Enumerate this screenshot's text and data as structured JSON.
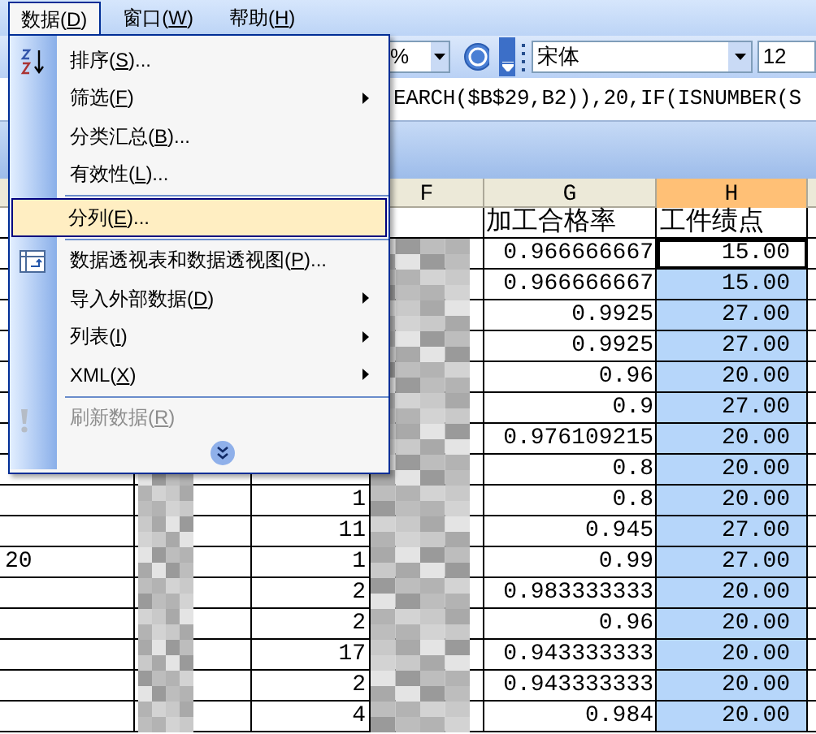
{
  "menubar": [
    {
      "before": "数据(",
      "key": "D",
      "after": ")",
      "selected": true
    },
    {
      "before": "窗口(",
      "key": "W",
      "after": ")",
      "selected": false
    },
    {
      "before": "帮助(",
      "key": "H",
      "after": ")",
      "selected": false
    }
  ],
  "toolbar": {
    "zoom": "%",
    "font": "宋体",
    "size": "12"
  },
  "formula": "EARCH($B$29,B2)),20,IF(ISNUMBER(S",
  "columns": [
    {
      "label": "F",
      "selected": false
    },
    {
      "label": "G",
      "selected": false
    },
    {
      "label": "H",
      "selected": true
    }
  ],
  "rows": [
    {
      "g": "加工合格率",
      "h": "工件绩点",
      "kind": "header",
      "selected": false,
      "active": false
    },
    {
      "g": "0.966666667",
      "h": "15.00",
      "kind": "number",
      "selected": false,
      "active": true
    },
    {
      "g": "0.966666667",
      "h": "15.00",
      "kind": "number",
      "selected": true,
      "active": false
    },
    {
      "g": "0.9925",
      "h": "27.00",
      "kind": "number",
      "selected": true,
      "active": false
    },
    {
      "g": "0.9925",
      "h": "27.00",
      "kind": "number",
      "selected": true,
      "active": false
    },
    {
      "g": "0.96",
      "h": "20.00",
      "kind": "number",
      "selected": true,
      "active": false
    },
    {
      "g": "0.9",
      "h": "27.00",
      "kind": "number",
      "selected": true,
      "active": false
    },
    {
      "g": "0.976109215",
      "h": "20.00",
      "kind": "number",
      "selected": true,
      "active": false
    },
    {
      "g": "0.8",
      "h": "20.00",
      "kind": "number",
      "selected": true,
      "active": false
    },
    {
      "e": "1",
      "g": "0.8",
      "h": "20.00",
      "kind": "number",
      "selected": true,
      "active": false
    },
    {
      "e": "11",
      "g": "0.945",
      "h": "27.00",
      "kind": "number",
      "selected": true,
      "active": false
    },
    {
      "a": "20",
      "e": "1",
      "g": "0.99",
      "h": "27.00",
      "kind": "number",
      "selected": true,
      "active": false
    },
    {
      "e": "2",
      "g": "0.983333333",
      "h": "20.00",
      "kind": "number",
      "selected": true,
      "active": false
    },
    {
      "e": "2",
      "g": "0.96",
      "h": "20.00",
      "kind": "number",
      "selected": true,
      "active": false
    },
    {
      "e": "17",
      "g": "0.943333333",
      "h": "20.00",
      "kind": "number",
      "selected": true,
      "active": false
    },
    {
      "e": "2",
      "g": "0.943333333",
      "h": "20.00",
      "kind": "number",
      "selected": true,
      "active": false
    },
    {
      "e": "4",
      "g": "0.984",
      "h": "20.00",
      "kind": "number",
      "selected": true,
      "active": false
    }
  ],
  "menu": {
    "items": [
      {
        "kind": "item",
        "before": "排序(",
        "key": "S",
        "after": ")...",
        "submenu": false,
        "disabled": false,
        "selected": false
      },
      {
        "kind": "item",
        "before": "筛选(",
        "key": "F",
        "after": ")",
        "submenu": true,
        "disabled": false,
        "selected": false
      },
      {
        "kind": "item",
        "before": "分类汇总(",
        "key": "B",
        "after": ")...",
        "submenu": false,
        "disabled": false,
        "selected": false
      },
      {
        "kind": "item",
        "before": "有效性(",
        "key": "L",
        "after": ")...",
        "submenu": false,
        "disabled": false,
        "selected": false
      },
      {
        "kind": "separator"
      },
      {
        "kind": "item",
        "before": "分列(",
        "key": "E",
        "after": ")...",
        "submenu": false,
        "disabled": false,
        "selected": true
      },
      {
        "kind": "separator"
      },
      {
        "kind": "item",
        "before": "数据透视表和数据透视图(",
        "key": "P",
        "after": ")...",
        "submenu": false,
        "disabled": false,
        "selected": false
      },
      {
        "kind": "item",
        "before": "导入外部数据(",
        "key": "D",
        "after": ")",
        "submenu": true,
        "disabled": false,
        "selected": false
      },
      {
        "kind": "item",
        "before": "列表(",
        "key": "I",
        "after": ")",
        "submenu": true,
        "disabled": false,
        "selected": false
      },
      {
        "kind": "item",
        "before": "XML(",
        "key": "X",
        "after": ")",
        "submenu": true,
        "disabled": false,
        "selected": false
      },
      {
        "kind": "separator"
      },
      {
        "kind": "item",
        "before": "刷新数据(",
        "key": "R",
        "after": ")",
        "submenu": false,
        "disabled": true,
        "selected": false
      }
    ],
    "expand": true
  }
}
